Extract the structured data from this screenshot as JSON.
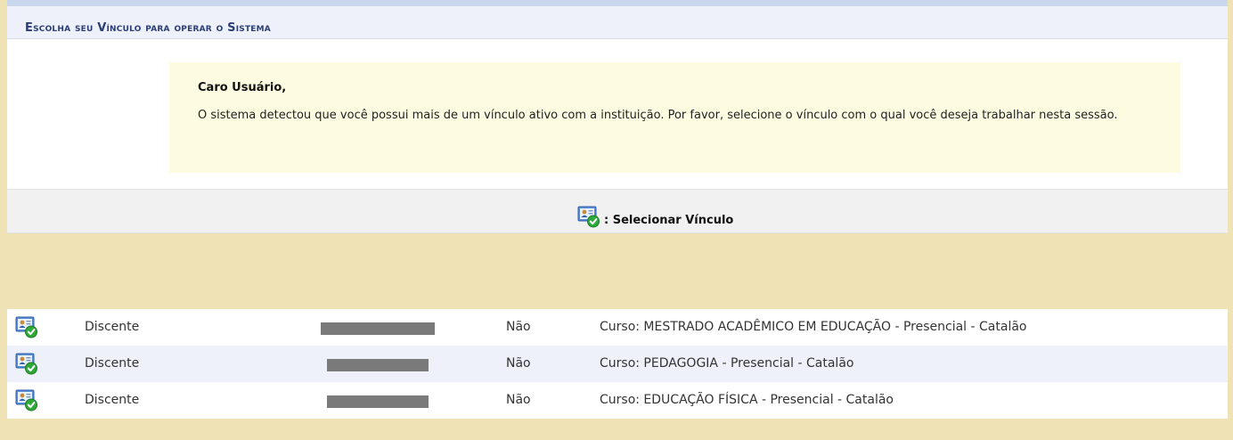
{
  "header": {
    "title": "Escolha seu Vínculo para operar o Sistema"
  },
  "notice": {
    "title": "Caro Usuário,",
    "body": "O sistema detectou que você possui mais de um vínculo ativo com a instituição. Por favor, selecione o vínculo com o qual você deseja trabalhar nesta sessão."
  },
  "legend": {
    "icon": "user-card-check-icon",
    "label": ": Selecionar Vínculo"
  },
  "rows": [
    {
      "icon": "user-card-check-icon",
      "type": "Discente",
      "identifier_redacted": true,
      "flag": "Não",
      "description": "Curso: MESTRADO ACADÊMICO EM EDUCAÇÃO - Presencial - Catalão"
    },
    {
      "icon": "user-card-check-icon",
      "type": "Discente",
      "identifier_redacted": true,
      "flag": "Não",
      "description": "Curso: PEDAGOGIA - Presencial - Catalão"
    },
    {
      "icon": "user-card-check-icon",
      "type": "Discente",
      "identifier_redacted": true,
      "flag": "Não",
      "description": "Curso: EDUCAÇÃO FÍSICA - Presencial - Catalão"
    }
  ],
  "colors": {
    "header_text": "#2a3e75",
    "notice_bg": "#fdfbe0",
    "page_bg": "#efe2b5",
    "row_alt": "#eef1f9"
  }
}
